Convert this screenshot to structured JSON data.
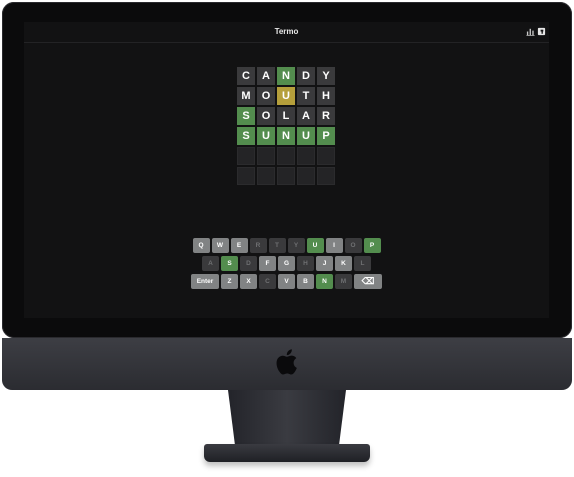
{
  "app": {
    "title": "Termo"
  },
  "header": {
    "icons": [
      "stats-icon",
      "help-icon"
    ]
  },
  "board": {
    "rows": [
      [
        {
          "l": "C",
          "s": "absent"
        },
        {
          "l": "A",
          "s": "absent"
        },
        {
          "l": "N",
          "s": "correct"
        },
        {
          "l": "D",
          "s": "absent"
        },
        {
          "l": "Y",
          "s": "absent"
        }
      ],
      [
        {
          "l": "M",
          "s": "absent"
        },
        {
          "l": "O",
          "s": "absent"
        },
        {
          "l": "U",
          "s": "present"
        },
        {
          "l": "T",
          "s": "absent"
        },
        {
          "l": "H",
          "s": "absent"
        }
      ],
      [
        {
          "l": "S",
          "s": "correct"
        },
        {
          "l": "O",
          "s": "absent"
        },
        {
          "l": "L",
          "s": "absent"
        },
        {
          "l": "A",
          "s": "absent"
        },
        {
          "l": "R",
          "s": "absent"
        }
      ],
      [
        {
          "l": "S",
          "s": "correct"
        },
        {
          "l": "U",
          "s": "correct"
        },
        {
          "l": "N",
          "s": "correct"
        },
        {
          "l": "U",
          "s": "correct"
        },
        {
          "l": "P",
          "s": "correct"
        }
      ],
      [
        {
          "l": "",
          "s": "empty"
        },
        {
          "l": "",
          "s": "empty"
        },
        {
          "l": "",
          "s": "empty"
        },
        {
          "l": "",
          "s": "empty"
        },
        {
          "l": "",
          "s": "empty"
        }
      ],
      [
        {
          "l": "",
          "s": "empty"
        },
        {
          "l": "",
          "s": "empty"
        },
        {
          "l": "",
          "s": "empty"
        },
        {
          "l": "",
          "s": "empty"
        },
        {
          "l": "",
          "s": "empty"
        }
      ]
    ]
  },
  "keyboard": {
    "rows": [
      [
        {
          "k": "Q",
          "s": "unused"
        },
        {
          "k": "W",
          "s": "unused"
        },
        {
          "k": "E",
          "s": "unused"
        },
        {
          "k": "R",
          "s": "absent"
        },
        {
          "k": "T",
          "s": "absent"
        },
        {
          "k": "Y",
          "s": "absent"
        },
        {
          "k": "U",
          "s": "correct"
        },
        {
          "k": "I",
          "s": "unused"
        },
        {
          "k": "O",
          "s": "absent"
        },
        {
          "k": "P",
          "s": "correct"
        }
      ],
      [
        {
          "k": "A",
          "s": "absent"
        },
        {
          "k": "S",
          "s": "correct"
        },
        {
          "k": "D",
          "s": "absent"
        },
        {
          "k": "F",
          "s": "unused"
        },
        {
          "k": "G",
          "s": "unused"
        },
        {
          "k": "H",
          "s": "absent"
        },
        {
          "k": "J",
          "s": "unused"
        },
        {
          "k": "K",
          "s": "unused"
        },
        {
          "k": "L",
          "s": "absent"
        }
      ],
      [
        {
          "k": "Enter",
          "s": "unused",
          "wide": true
        },
        {
          "k": "Z",
          "s": "unused"
        },
        {
          "k": "X",
          "s": "unused"
        },
        {
          "k": "C",
          "s": "absent"
        },
        {
          "k": "V",
          "s": "unused"
        },
        {
          "k": "B",
          "s": "unused"
        },
        {
          "k": "N",
          "s": "correct"
        },
        {
          "k": "M",
          "s": "absent"
        },
        {
          "k": "⌫",
          "s": "unused",
          "wide": true,
          "icon": "backspace-icon"
        }
      ]
    ]
  },
  "colors": {
    "correct": "#538d4e",
    "present": "#b59f3b",
    "absent": "#3a3a3c",
    "unused": "#818384",
    "background": "#121213"
  }
}
